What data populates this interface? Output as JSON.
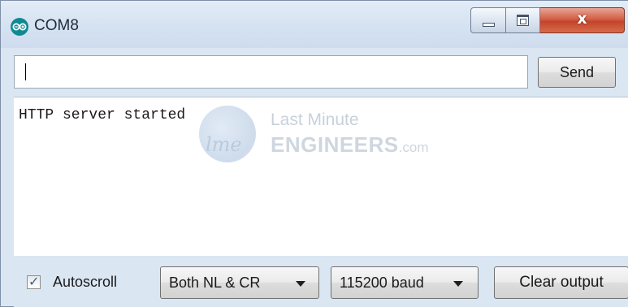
{
  "window": {
    "title": "COM8",
    "icon": "arduino-icon",
    "controls": {
      "minimize_icon": "minimize-icon",
      "maximize_icon": "maximize-icon",
      "close_icon": "close-icon",
      "close_glyph": "x"
    }
  },
  "input": {
    "value": "",
    "placeholder": "",
    "send_label": "Send"
  },
  "output": {
    "text": "HTTP server started"
  },
  "watermark": {
    "logo_text": "lme",
    "line1": "Last Minute",
    "line2": "ENGINEERS",
    "line2_suffix": ".com"
  },
  "bottom": {
    "autoscroll_label": "Autoscroll",
    "autoscroll_checked": true,
    "line_ending": "Both NL & CR",
    "baud": "115200 baud",
    "clear_label": "Clear output"
  },
  "colors": {
    "chrome": "#dbe6f3",
    "close_button": "#c3452b",
    "icon_teal": "#0f8a92"
  }
}
